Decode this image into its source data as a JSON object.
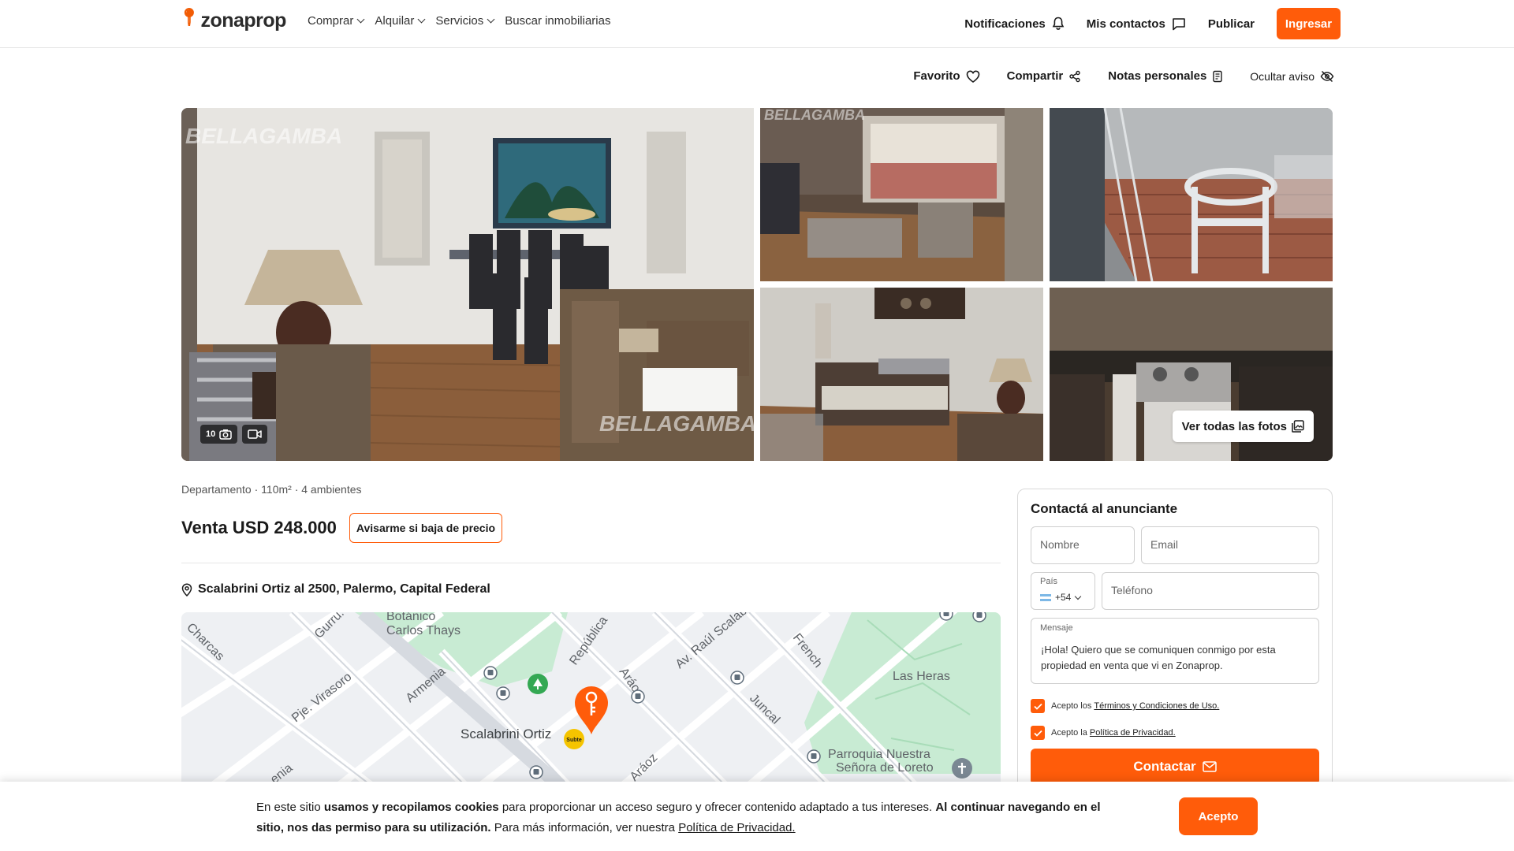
{
  "header": {
    "logo_text": "zonaprop",
    "nav": [
      {
        "label": "Comprar"
      },
      {
        "label": "Alquilar"
      },
      {
        "label": "Servicios"
      },
      {
        "label": "Buscar inmobiliarias"
      }
    ],
    "notifications": "Notificaciones",
    "contacts": "Mis contactos",
    "publish": "Publicar",
    "login": "Ingresar"
  },
  "actions": {
    "favorite": "Favorito",
    "share": "Compartir",
    "notes": "Notas personales",
    "hide": "Ocultar aviso"
  },
  "gallery": {
    "photo_count": "10",
    "watermark": "BELLAGAMBA",
    "view_all": "Ver todas las fotos"
  },
  "listing": {
    "meta": "Departamento · 110m² · 4 ambientes",
    "price": "Venta USD 248.000",
    "price_alert": "Avisarme si baja de precio",
    "address": "Scalabrini Ortiz al 2500, Palermo, Capital Federal"
  },
  "map": {
    "labels": {
      "botanico": "Botánico",
      "carlos": "Carlos Thays",
      "charcas": "Charcas",
      "guru": "Gurru.",
      "virasoro": "Pje. Virasoro",
      "armenia": "Armenia",
      "republica": "República",
      "araoz_upper": "Aráoz",
      "raul": "Av. Raúl Scalab.",
      "french": "French",
      "juncal": "Juncal",
      "heras": "Las Heras",
      "scalabrini": "Scalabrini Ortiz",
      "araoz": "Aráoz",
      "parroquia": "Parroquia Nuestra",
      "senora": "Señora de Loreto",
      "subte": "Subte",
      "enia": "enia"
    }
  },
  "contact": {
    "title": "Contactá al anunciante",
    "name_placeholder": "Nombre",
    "email_placeholder": "Email",
    "country_label": "País",
    "country_code": "+54",
    "phone_placeholder": "Teléfono",
    "message_label": "Mensaje",
    "message": "¡Hola! Quiero que se comuniquen conmigo por esta propiedad en venta que vi en Zonaprop.",
    "terms_prefix": "Acepto los",
    "terms_link": "Términos y Condiciones de Uso.",
    "privacy_prefix": "Acepto la",
    "privacy_link": "Política de Privacidad.",
    "submit": "Contactar"
  },
  "cookie": {
    "t1": "En este sitio ",
    "t2": "usamos y recopilamos cookies",
    "t3": " para proporcionar un acceso seguro y ofrecer contenido adaptado a tus intereses. ",
    "t4": "Al continuar navegando en el sitio, nos das permiso para su utilización.",
    "t5": " Para más información, ver nuestra ",
    "link": "Política de Privacidad.",
    "accept": "Acepto"
  },
  "colors": {
    "brand": "#ff5c0a",
    "map_green": "#c8ebd3",
    "map_bg": "#eef0f3"
  }
}
